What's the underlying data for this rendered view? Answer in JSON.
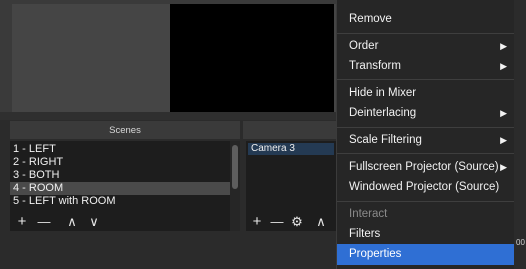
{
  "scenes": {
    "title": "Scenes",
    "items": [
      "1 - LEFT",
      "2 - RIGHT",
      "3 - BOTH",
      "4 - ROOM",
      "5 - LEFT with ROOM"
    ],
    "selected_index": 3
  },
  "sources": {
    "items": [
      "Camera 3"
    ]
  },
  "toolbar": {
    "add": "+",
    "remove": "—",
    "up": "∧",
    "down": "∨",
    "gear": "⚙"
  },
  "context_menu": {
    "items": [
      {
        "label": "Remove",
        "submenu": false,
        "enabled": true
      },
      {
        "label": "Order",
        "submenu": true,
        "enabled": true
      },
      {
        "label": "Transform",
        "submenu": true,
        "enabled": true
      },
      {
        "label": "Hide in Mixer",
        "submenu": false,
        "enabled": true
      },
      {
        "label": "Deinterlacing",
        "submenu": true,
        "enabled": true
      },
      {
        "label": "Scale Filtering",
        "submenu": true,
        "enabled": true
      },
      {
        "label": "Fullscreen Projector (Source)",
        "submenu": true,
        "enabled": true
      },
      {
        "label": "Windowed Projector (Source)",
        "submenu": false,
        "enabled": true
      },
      {
        "label": "Interact",
        "submenu": false,
        "enabled": false
      },
      {
        "label": "Filters",
        "submenu": false,
        "enabled": true
      },
      {
        "label": "Properties",
        "submenu": false,
        "enabled": true,
        "highlighted": true
      }
    ]
  },
  "edge_text": "00",
  "colors": {
    "highlight": "#2f6fd4",
    "menu_bg": "#262626",
    "list_bg": "#1d1d1d",
    "selected_source": "#243a53"
  }
}
